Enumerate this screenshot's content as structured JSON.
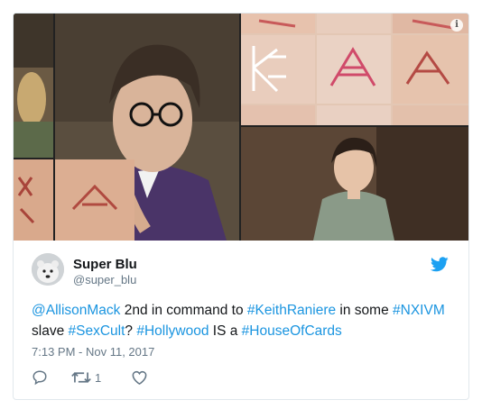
{
  "tweet": {
    "author_name": "Super Blu",
    "author_handle": "@super_blu",
    "text_parts": [
      {
        "t": "@AllisonMack",
        "tag": true
      },
      {
        "t": " 2nd in command to ",
        "tag": false
      },
      {
        "t": "#KeithRaniere",
        "tag": true
      },
      {
        "t": " in some ",
        "tag": false
      },
      {
        "t": "#NXIVM",
        "tag": true
      },
      {
        "t": " slave ",
        "tag": false
      },
      {
        "t": "#SexCult",
        "tag": true
      },
      {
        "t": "? ",
        "tag": false
      },
      {
        "t": "#Hollywood",
        "tag": true
      },
      {
        "t": " IS a ",
        "tag": false
      },
      {
        "t": "#HouseOfCards",
        "tag": true
      }
    ],
    "timestamp": "7:13 PM - Nov 11, 2017",
    "retweet_count": "1"
  },
  "media": {
    "info_glyph": "i"
  },
  "icons": {
    "twitter_bird": "twitter-bird-icon",
    "reply": "reply-icon",
    "retweet": "retweet-icon",
    "like": "heart-icon",
    "info": "info-icon"
  },
  "colors": {
    "link": "#1b95e0",
    "muted": "#657786",
    "twitter_blue": "#1da1f2",
    "border": "#e1e8ed"
  }
}
